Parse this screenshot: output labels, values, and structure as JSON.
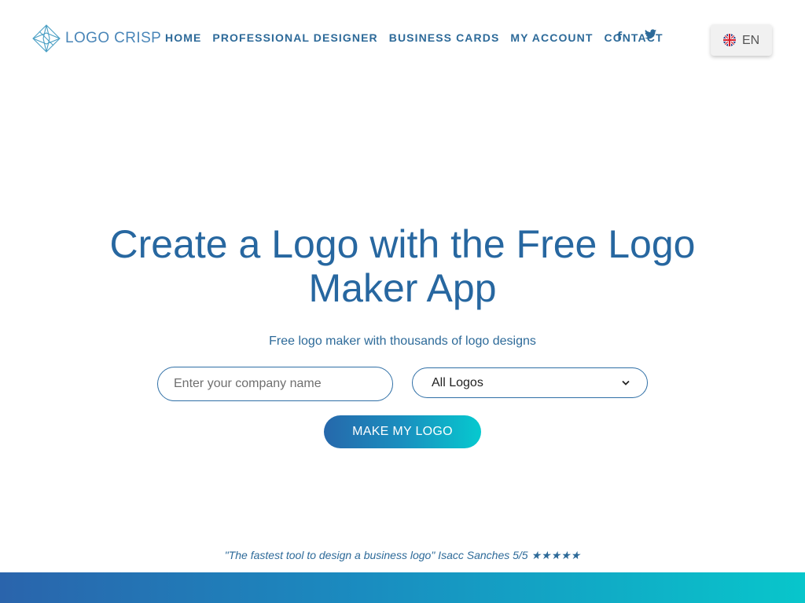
{
  "header": {
    "logo_text": "LOGO CRISP",
    "logo_icon": "diamond-logo-icon",
    "nav": [
      {
        "label": "HOME"
      },
      {
        "label": "PROFESSIONAL DESIGNER"
      },
      {
        "label": "BUSINESS CARDS"
      },
      {
        "label": "MY ACCOUNT"
      },
      {
        "label": "CONTACT"
      }
    ],
    "social": {
      "facebook": "f",
      "twitter_icon": "twitter-bird-icon"
    },
    "language": {
      "label": "EN",
      "flag_icon": "uk-flag-icon"
    }
  },
  "hero": {
    "title": "Create a Logo with the Free Logo Maker App",
    "subtitle": "Free logo maker with thousands of logo designs",
    "company_input": {
      "value": "",
      "placeholder": "Enter your company name"
    },
    "category_select": {
      "selected": "All Logos",
      "chevron_icon": "chevron-down-icon"
    },
    "cta_label": "MAKE MY LOGO"
  },
  "testimonial": {
    "text": "\"The fastest tool to design a business logo\" Isacc Sanches 5/5 ★★★★★"
  },
  "colors": {
    "primary": "#2767a0",
    "accent_start": "#2668ab",
    "accent_end": "#06c9cf",
    "lang_bg": "#f1f1f1"
  }
}
